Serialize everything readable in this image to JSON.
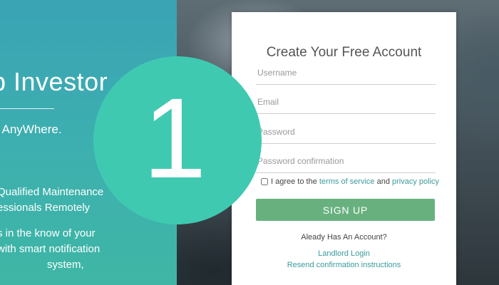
{
  "left_panel": {
    "title": "p Investor",
    "tagline": ". AnyWhere.",
    "feature_1": [
      "Qualified Maintenance",
      "essionals Remotely"
    ],
    "feature_2": [
      "s in the know of your",
      "with smart notification",
      "system,"
    ]
  },
  "signup_form": {
    "title": "Create Your Free Account",
    "username_placeholder": "Username",
    "email_placeholder": "Email",
    "password_placeholder": "Password",
    "password_confirmation_placeholder": "Password confirmation",
    "terms_prefix": "I agree to the",
    "terms_link": "terms of service",
    "terms_and": "and",
    "privacy_link": "privacy policy",
    "submit_label": "SIGN UP",
    "account_question": "Aleady Has An Account?",
    "landlord_login": "Landlord Login",
    "resend_confirmation": "Resend confirmation instructions"
  },
  "step_badge": {
    "number": "1"
  },
  "colors": {
    "panel_teal": "#3dafb0",
    "badge": "#3fc9b1",
    "button_green": "#68b17f",
    "link": "#3c9a9c"
  }
}
